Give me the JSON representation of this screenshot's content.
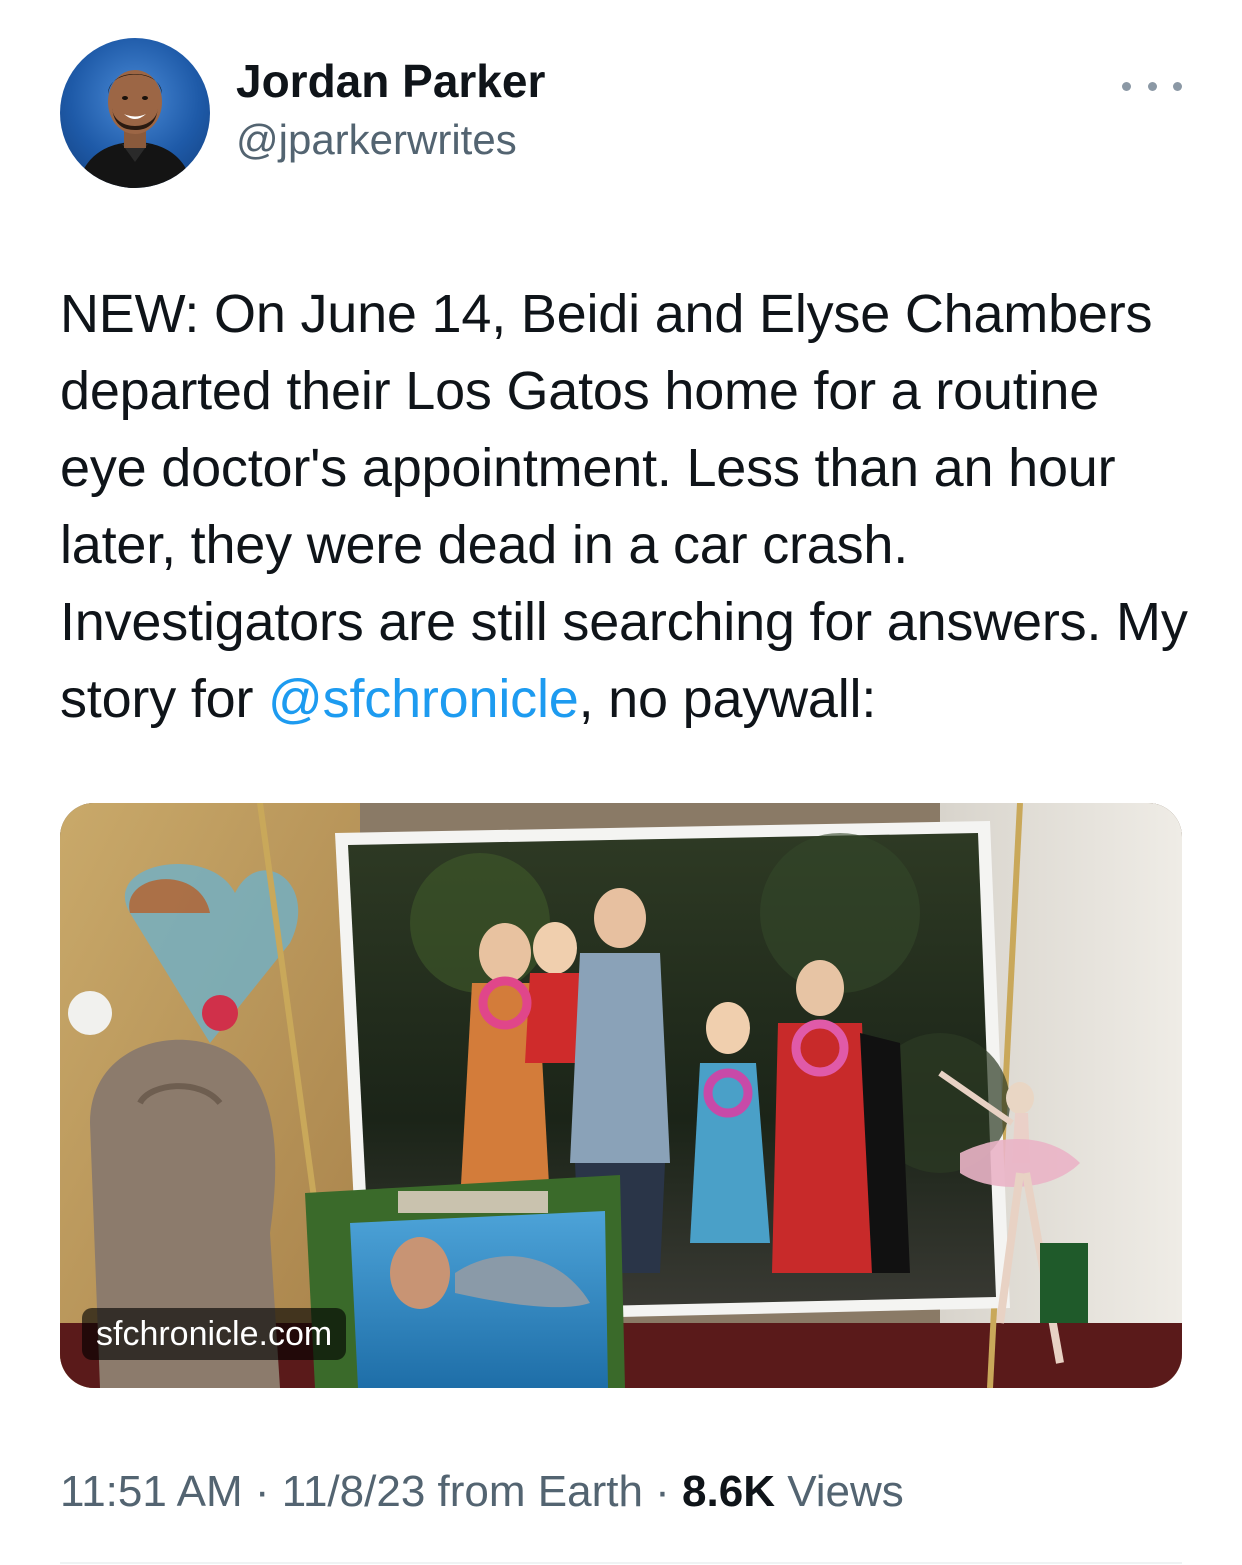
{
  "author": {
    "display_name": "Jordan Parker",
    "handle": "@jparkerwrites",
    "avatar_icon": "user-avatar"
  },
  "more_icon": "more-horizontal-icon",
  "tweet": {
    "text_before_mention": "NEW: On June 14, Beidi and Elyse Chambers departed their Los Gatos home for a routine eye doctor's appointment. Less than an hour later, they were dead in a car crash. Investigators are still searching for answers. My story for ",
    "mention": "@sfchronicle",
    "text_after_mention": ", no paywall:"
  },
  "link_card": {
    "domain": "sfchronicle.com",
    "image_description_icon": "article-photo"
  },
  "meta": {
    "time": "11:51 AM",
    "separator1": " · ",
    "date": "11/8/23",
    "source": " from Earth",
    "separator2": " · ",
    "views_count": "8.6K",
    "views_label": " Views"
  },
  "colors": {
    "link": "#1d9bf0",
    "text": "#0f1419",
    "secondary": "#536471"
  }
}
